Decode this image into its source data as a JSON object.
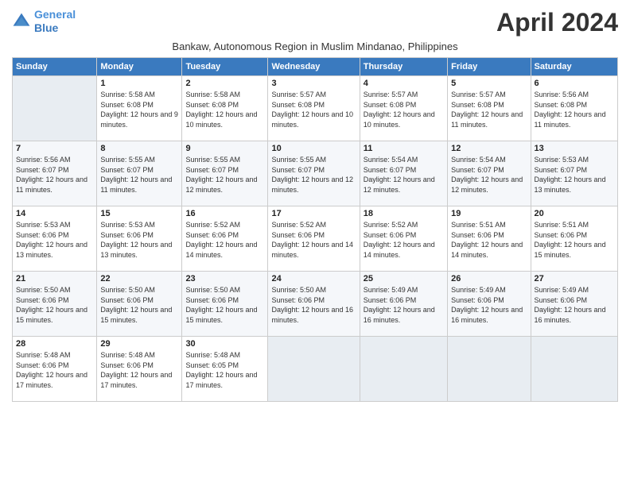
{
  "logo": {
    "line1": "General",
    "line2": "Blue"
  },
  "title": "April 2024",
  "subtitle": "Bankaw, Autonomous Region in Muslim Mindanao, Philippines",
  "headers": [
    "Sunday",
    "Monday",
    "Tuesday",
    "Wednesday",
    "Thursday",
    "Friday",
    "Saturday"
  ],
  "weeks": [
    [
      {
        "num": "",
        "sunrise": "",
        "sunset": "",
        "daylight": ""
      },
      {
        "num": "1",
        "sunrise": "Sunrise: 5:58 AM",
        "sunset": "Sunset: 6:08 PM",
        "daylight": "Daylight: 12 hours and 9 minutes."
      },
      {
        "num": "2",
        "sunrise": "Sunrise: 5:58 AM",
        "sunset": "Sunset: 6:08 PM",
        "daylight": "Daylight: 12 hours and 10 minutes."
      },
      {
        "num": "3",
        "sunrise": "Sunrise: 5:57 AM",
        "sunset": "Sunset: 6:08 PM",
        "daylight": "Daylight: 12 hours and 10 minutes."
      },
      {
        "num": "4",
        "sunrise": "Sunrise: 5:57 AM",
        "sunset": "Sunset: 6:08 PM",
        "daylight": "Daylight: 12 hours and 10 minutes."
      },
      {
        "num": "5",
        "sunrise": "Sunrise: 5:57 AM",
        "sunset": "Sunset: 6:08 PM",
        "daylight": "Daylight: 12 hours and 11 minutes."
      },
      {
        "num": "6",
        "sunrise": "Sunrise: 5:56 AM",
        "sunset": "Sunset: 6:08 PM",
        "daylight": "Daylight: 12 hours and 11 minutes."
      }
    ],
    [
      {
        "num": "7",
        "sunrise": "Sunrise: 5:56 AM",
        "sunset": "Sunset: 6:07 PM",
        "daylight": "Daylight: 12 hours and 11 minutes."
      },
      {
        "num": "8",
        "sunrise": "Sunrise: 5:55 AM",
        "sunset": "Sunset: 6:07 PM",
        "daylight": "Daylight: 12 hours and 11 minutes."
      },
      {
        "num": "9",
        "sunrise": "Sunrise: 5:55 AM",
        "sunset": "Sunset: 6:07 PM",
        "daylight": "Daylight: 12 hours and 12 minutes."
      },
      {
        "num": "10",
        "sunrise": "Sunrise: 5:55 AM",
        "sunset": "Sunset: 6:07 PM",
        "daylight": "Daylight: 12 hours and 12 minutes."
      },
      {
        "num": "11",
        "sunrise": "Sunrise: 5:54 AM",
        "sunset": "Sunset: 6:07 PM",
        "daylight": "Daylight: 12 hours and 12 minutes."
      },
      {
        "num": "12",
        "sunrise": "Sunrise: 5:54 AM",
        "sunset": "Sunset: 6:07 PM",
        "daylight": "Daylight: 12 hours and 12 minutes."
      },
      {
        "num": "13",
        "sunrise": "Sunrise: 5:53 AM",
        "sunset": "Sunset: 6:07 PM",
        "daylight": "Daylight: 12 hours and 13 minutes."
      }
    ],
    [
      {
        "num": "14",
        "sunrise": "Sunrise: 5:53 AM",
        "sunset": "Sunset: 6:06 PM",
        "daylight": "Daylight: 12 hours and 13 minutes."
      },
      {
        "num": "15",
        "sunrise": "Sunrise: 5:53 AM",
        "sunset": "Sunset: 6:06 PM",
        "daylight": "Daylight: 12 hours and 13 minutes."
      },
      {
        "num": "16",
        "sunrise": "Sunrise: 5:52 AM",
        "sunset": "Sunset: 6:06 PM",
        "daylight": "Daylight: 12 hours and 14 minutes."
      },
      {
        "num": "17",
        "sunrise": "Sunrise: 5:52 AM",
        "sunset": "Sunset: 6:06 PM",
        "daylight": "Daylight: 12 hours and 14 minutes."
      },
      {
        "num": "18",
        "sunrise": "Sunrise: 5:52 AM",
        "sunset": "Sunset: 6:06 PM",
        "daylight": "Daylight: 12 hours and 14 minutes."
      },
      {
        "num": "19",
        "sunrise": "Sunrise: 5:51 AM",
        "sunset": "Sunset: 6:06 PM",
        "daylight": "Daylight: 12 hours and 14 minutes."
      },
      {
        "num": "20",
        "sunrise": "Sunrise: 5:51 AM",
        "sunset": "Sunset: 6:06 PM",
        "daylight": "Daylight: 12 hours and 15 minutes."
      }
    ],
    [
      {
        "num": "21",
        "sunrise": "Sunrise: 5:50 AM",
        "sunset": "Sunset: 6:06 PM",
        "daylight": "Daylight: 12 hours and 15 minutes."
      },
      {
        "num": "22",
        "sunrise": "Sunrise: 5:50 AM",
        "sunset": "Sunset: 6:06 PM",
        "daylight": "Daylight: 12 hours and 15 minutes."
      },
      {
        "num": "23",
        "sunrise": "Sunrise: 5:50 AM",
        "sunset": "Sunset: 6:06 PM",
        "daylight": "Daylight: 12 hours and 15 minutes."
      },
      {
        "num": "24",
        "sunrise": "Sunrise: 5:50 AM",
        "sunset": "Sunset: 6:06 PM",
        "daylight": "Daylight: 12 hours and 16 minutes."
      },
      {
        "num": "25",
        "sunrise": "Sunrise: 5:49 AM",
        "sunset": "Sunset: 6:06 PM",
        "daylight": "Daylight: 12 hours and 16 minutes."
      },
      {
        "num": "26",
        "sunrise": "Sunrise: 5:49 AM",
        "sunset": "Sunset: 6:06 PM",
        "daylight": "Daylight: 12 hours and 16 minutes."
      },
      {
        "num": "27",
        "sunrise": "Sunrise: 5:49 AM",
        "sunset": "Sunset: 6:06 PM",
        "daylight": "Daylight: 12 hours and 16 minutes."
      }
    ],
    [
      {
        "num": "28",
        "sunrise": "Sunrise: 5:48 AM",
        "sunset": "Sunset: 6:06 PM",
        "daylight": "Daylight: 12 hours and 17 minutes."
      },
      {
        "num": "29",
        "sunrise": "Sunrise: 5:48 AM",
        "sunset": "Sunset: 6:06 PM",
        "daylight": "Daylight: 12 hours and 17 minutes."
      },
      {
        "num": "30",
        "sunrise": "Sunrise: 5:48 AM",
        "sunset": "Sunset: 6:05 PM",
        "daylight": "Daylight: 12 hours and 17 minutes."
      },
      {
        "num": "",
        "sunrise": "",
        "sunset": "",
        "daylight": ""
      },
      {
        "num": "",
        "sunrise": "",
        "sunset": "",
        "daylight": ""
      },
      {
        "num": "",
        "sunrise": "",
        "sunset": "",
        "daylight": ""
      },
      {
        "num": "",
        "sunrise": "",
        "sunset": "",
        "daylight": ""
      }
    ]
  ]
}
